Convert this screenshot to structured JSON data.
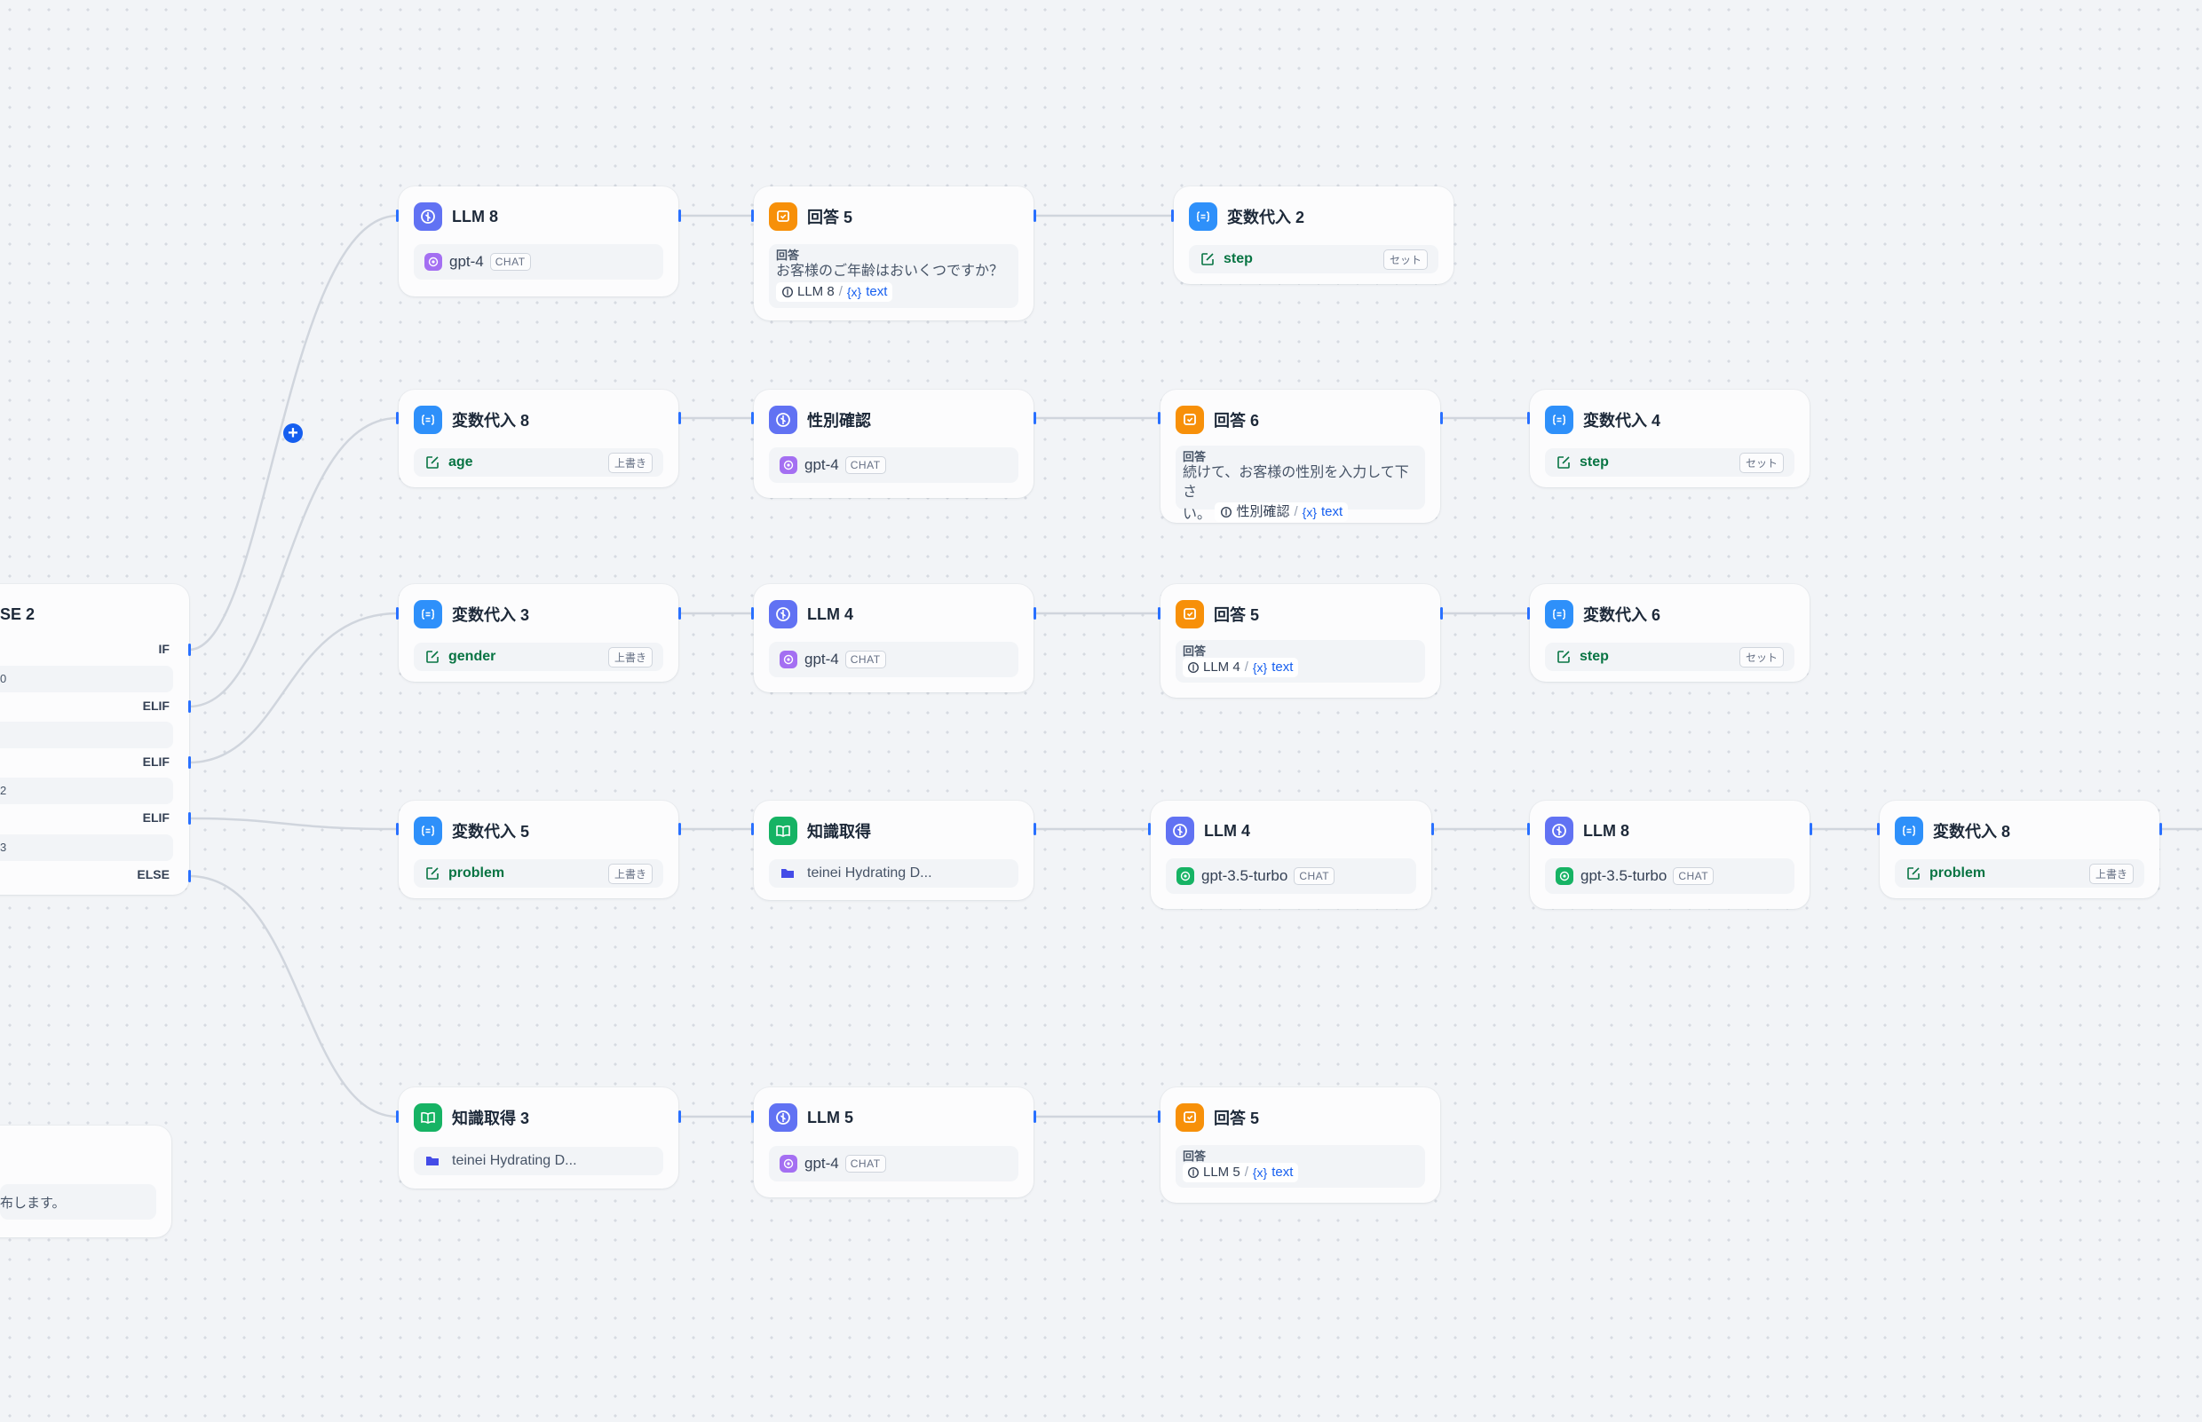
{
  "canvas": {
    "if_else_node": {
      "title": "SE 2",
      "branches": [
        "IF",
        "ELIF",
        "ELIF",
        "ELIF",
        "ELSE"
      ],
      "condition_fragments": [
        "0",
        "",
        "2",
        "3"
      ]
    },
    "partial_node": {
      "text": "布します。"
    },
    "add_button": {
      "label": "+"
    }
  },
  "nodes": {
    "r1": [
      {
        "type": "llm",
        "icon": "llm-icon",
        "title": "LLM 8",
        "model": "gpt-4",
        "mode": "CHAT"
      },
      {
        "type": "answer",
        "icon": "answer-icon",
        "title": "回答 5",
        "label": "回答",
        "text": "お客様のご年齢はおいくつですか？",
        "ref_source": "LLM 8",
        "ref_var": "text"
      },
      {
        "type": "var",
        "icon": "variable-assign-icon",
        "title": "変数代入 2",
        "var": "step",
        "op": "セット"
      }
    ],
    "r2": [
      {
        "type": "var",
        "icon": "variable-assign-icon",
        "title": "変数代入 8",
        "var": "age",
        "op": "上書き"
      },
      {
        "type": "llm",
        "icon": "llm-icon",
        "title": "性別確認",
        "model": "gpt-4",
        "mode": "CHAT"
      },
      {
        "type": "answer",
        "icon": "answer-icon",
        "title": "回答 6",
        "label": "回答",
        "text_line1": "続けて、お客様の性別を入力して下さ",
        "text_line2": "い。",
        "ref_source": "性別確認",
        "ref_var": "text"
      },
      {
        "type": "var",
        "icon": "variable-assign-icon",
        "title": "変数代入 4",
        "var": "step",
        "op": "セット"
      }
    ],
    "r3": [
      {
        "type": "var",
        "icon": "variable-assign-icon",
        "title": "変数代入 3",
        "var": "gender",
        "op": "上書き"
      },
      {
        "type": "llm",
        "icon": "llm-icon",
        "title": "LLM 4",
        "model": "gpt-4",
        "mode": "CHAT"
      },
      {
        "type": "answer",
        "icon": "answer-icon",
        "title": "回答 5",
        "label": "回答",
        "ref_source": "LLM 4",
        "ref_var": "text"
      },
      {
        "type": "var",
        "icon": "variable-assign-icon",
        "title": "変数代入 6",
        "var": "step",
        "op": "セット"
      }
    ],
    "r4": [
      {
        "type": "var",
        "icon": "variable-assign-icon",
        "title": "変数代入 5",
        "var": "problem",
        "op": "上書き"
      },
      {
        "type": "knowledge",
        "icon": "knowledge-icon",
        "title": "知識取得",
        "dataset": "teinei Hydrating D..."
      },
      {
        "type": "llm",
        "icon": "llm-icon",
        "title": "LLM 4",
        "model": "gpt-3.5-turbo",
        "mode": "CHAT"
      },
      {
        "type": "llm",
        "icon": "llm-icon",
        "title": "LLM 8",
        "model": "gpt-3.5-turbo",
        "mode": "CHAT"
      },
      {
        "type": "var",
        "icon": "variable-assign-icon",
        "title": "変数代入 8",
        "var": "problem",
        "op": "上書き"
      }
    ],
    "r5": [
      {
        "type": "knowledge",
        "icon": "knowledge-icon",
        "title": "知識取得 3",
        "dataset": "teinei Hydrating D..."
      },
      {
        "type": "llm",
        "icon": "llm-icon",
        "title": "LLM 5",
        "model": "gpt-4",
        "mode": "CHAT"
      },
      {
        "type": "answer",
        "icon": "answer-icon",
        "title": "回答 5",
        "label": "回答",
        "ref_source": "LLM 5",
        "ref_var": "text"
      }
    ]
  },
  "colors": {
    "llm": "#6172f3",
    "variable": "#2e90fa",
    "answer": "#f79009",
    "knowledge": "#16b364",
    "edge": "#d0d5dd",
    "handle": "#2970ff",
    "variable_text": "#087443",
    "ref_var": "#155eef"
  }
}
